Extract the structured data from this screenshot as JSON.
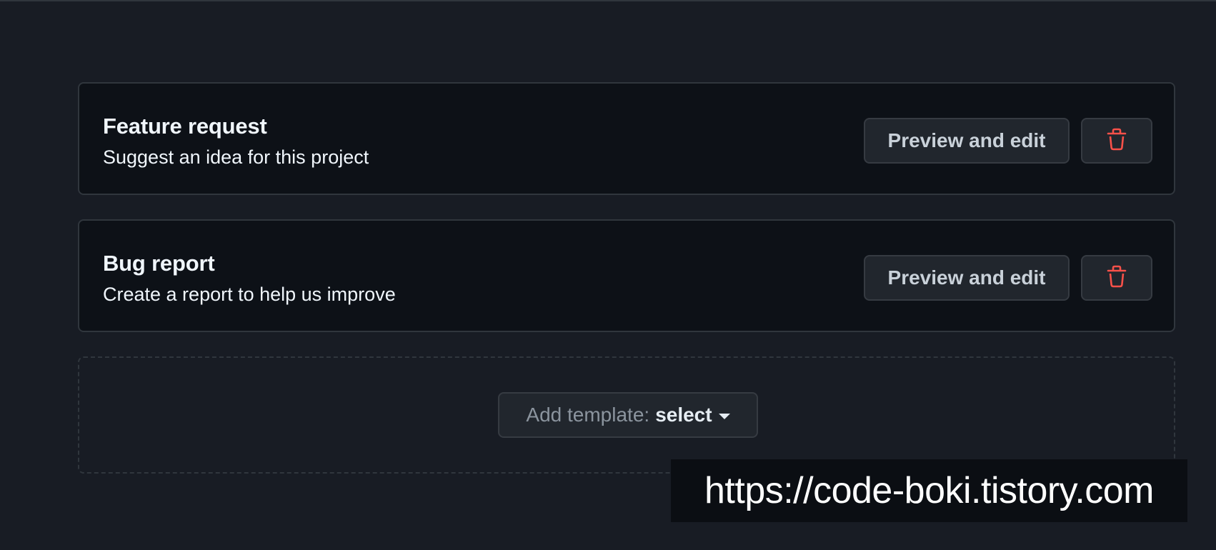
{
  "templates": [
    {
      "title": "Feature request",
      "description": "Suggest an idea for this project",
      "edit_label": "Preview and edit",
      "delete_icon": "trash-icon"
    },
    {
      "title": "Bug report",
      "description": "Create a report to help us improve",
      "edit_label": "Preview and edit",
      "delete_icon": "trash-icon"
    }
  ],
  "add_template": {
    "prefix": "Add template:",
    "select_label": "select",
    "icon": "caret-down-icon"
  },
  "watermark": {
    "text": "https://code-boki.tistory.com"
  },
  "colors": {
    "background": "#181c24",
    "card_background": "#0d1117",
    "border": "#30363d",
    "button_background": "#21262d",
    "danger": "#f85149",
    "text_primary": "#f0f6fc",
    "text_muted": "#8b949e"
  }
}
